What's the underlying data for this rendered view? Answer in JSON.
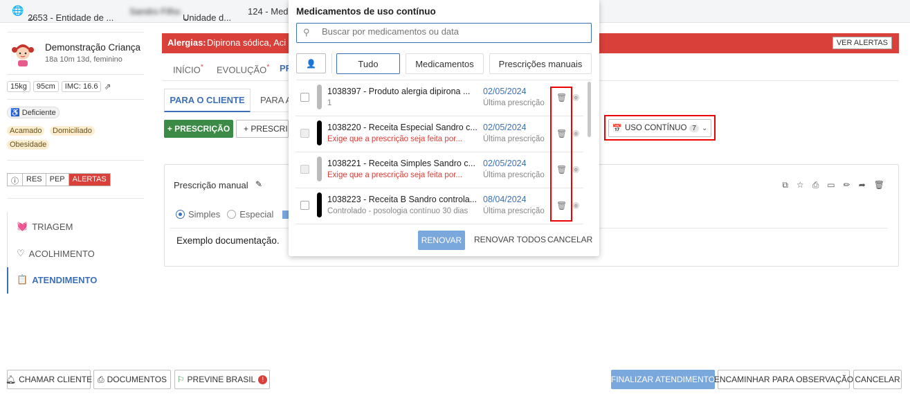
{
  "topbar": {
    "entity": "2653 - Entidade de ...",
    "user": "Sandro Filho",
    "unit": "Unidade d...",
    "sector": "124 - Med"
  },
  "patient": {
    "name": "Demonstração Criança",
    "details": "18a 10m 13d, feminino",
    "weight": "15kg",
    "height": "95cm",
    "imc": "IMC: 16.6",
    "deficiency": "Deficiente",
    "tags": [
      "Acamado",
      "Domiciliado",
      "Obesidade"
    ],
    "record_tabs": [
      "RES",
      "PEP",
      "ALERTAS"
    ]
  },
  "side_nav": [
    "TRIAGEM",
    "ACOLHIMENTO",
    "ATENDIMENTO"
  ],
  "alert_banner": {
    "label": "Alergias:",
    "text": "Dipirona sódica, Aci",
    "button": "VER ALERTAS"
  },
  "main_tabs": [
    "INÍCIO",
    "EVOLUÇÃO",
    "PR"
  ],
  "sub_tabs": [
    "PARA O CLIENTE",
    "PARA A"
  ],
  "actions": {
    "new_prescription": "+ PRESCRIÇÃO",
    "prescription2": "+ PRESCRI",
    "uso_continuo": "USO CONTÍNUO",
    "uso_count": "7"
  },
  "card": {
    "title": "Prescrição manual",
    "radio_simple": "Simples",
    "radio_special": "Especial",
    "body": "Exemplo documentação."
  },
  "popup": {
    "title": "Medicamentos de uso contínuo",
    "search_placeholder": "Buscar por medicamentos ou data",
    "filters": [
      "Tudo",
      "Medicamentos",
      "Prescrições manuais"
    ],
    "rows": [
      {
        "title": "1038397 - Produto alergia dipirona ...",
        "sub": "1",
        "date": "02/05/2024",
        "label": "Última prescrição",
        "bar": "#bbbbbb",
        "disabled": false,
        "warn": false
      },
      {
        "title": "1038220 - Receita Especial Sandro c...",
        "sub": "Exige que a prescrição seja feita por...",
        "date": "02/05/2024",
        "label": "Última prescrição",
        "bar": "#000000",
        "disabled": true,
        "warn": true
      },
      {
        "title": "1038221 - Receita Simples Sandro c...",
        "sub": "Exige que a prescrição seja feita por...",
        "date": "02/05/2024",
        "label": "Última prescrição",
        "bar": "#bbbbbb",
        "disabled": true,
        "warn": true
      },
      {
        "title": "1038223 - Receita B Sandro controla...",
        "sub": "Controlado - posologia contínuo 30 dias",
        "date": "08/04/2024",
        "label": "Última prescrição",
        "bar": "#000000",
        "disabled": false,
        "warn": false
      }
    ],
    "renew": "RENOVAR",
    "renew_all": "RENOVAR TODOS",
    "cancel": "CANCELAR"
  },
  "footer": {
    "call": "CHAMAR CLIENTE",
    "docs": "DOCUMENTOS",
    "previne": "PREVINE BRASIL",
    "finish": "FINALIZAR ATENDIMENTO",
    "forward": "ENCAMINHAR PARA OBSERVAÇÃO",
    "cancel": "CANCELAR"
  },
  "colors": {
    "alert_red": "#d9403a",
    "accent_blue": "#3c6fb5",
    "green": "#3b8a45",
    "highlight": "#e00000"
  }
}
